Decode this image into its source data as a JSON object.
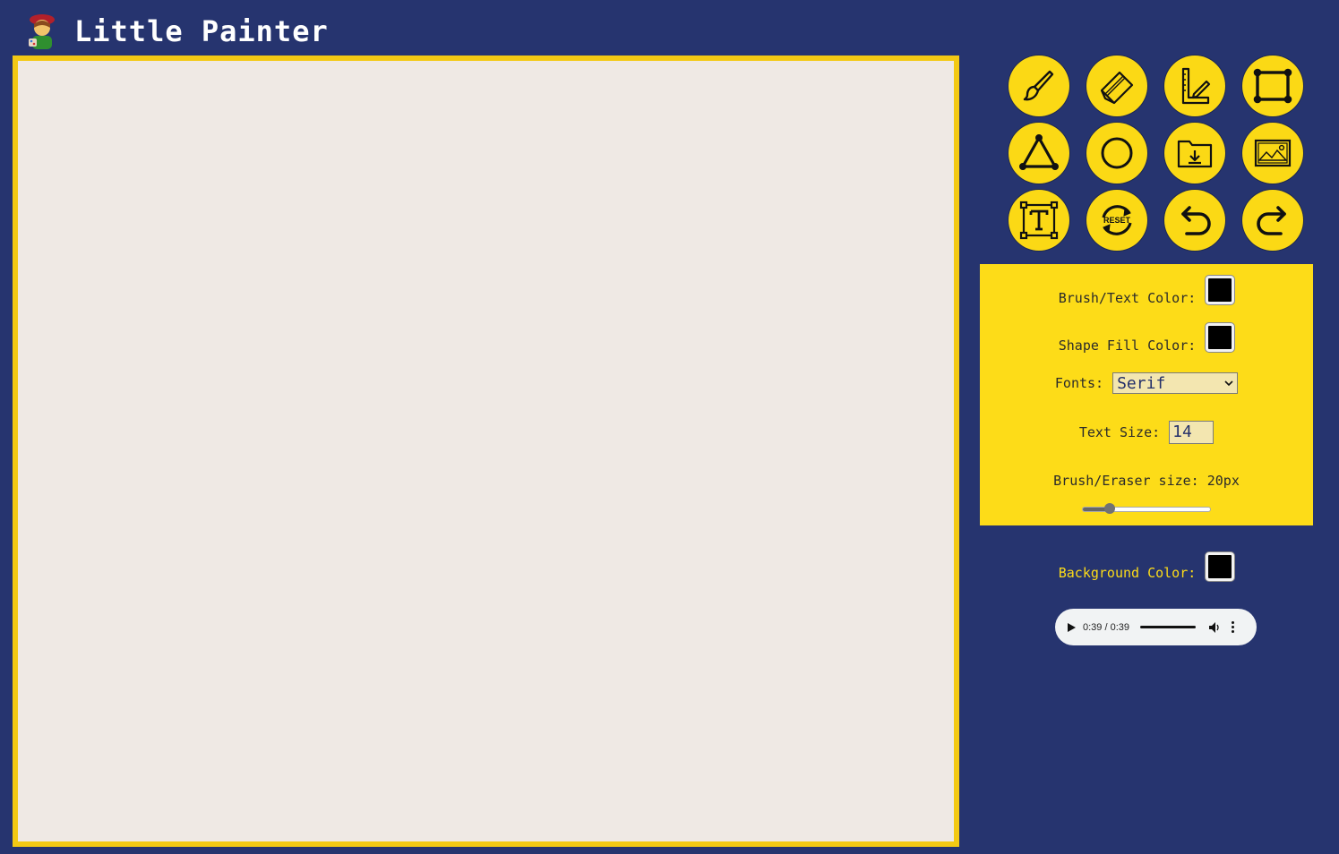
{
  "app": {
    "title": "Little Painter",
    "logo_icon": "painter-emoji-icon"
  },
  "colors": {
    "background": "#26346f",
    "accent": "#fbd915",
    "canvas": "#efe9e4"
  },
  "toolbar": {
    "tools": [
      {
        "name": "brush",
        "icon": "brush-icon"
      },
      {
        "name": "eraser",
        "icon": "eraser-icon"
      },
      {
        "name": "line",
        "icon": "ruler-pencil-icon"
      },
      {
        "name": "rectangle",
        "icon": "rectangle-icon"
      },
      {
        "name": "triangle",
        "icon": "triangle-icon"
      },
      {
        "name": "circle",
        "icon": "circle-icon"
      },
      {
        "name": "save",
        "icon": "download-folder-icon"
      },
      {
        "name": "image",
        "icon": "image-icon"
      },
      {
        "name": "text",
        "icon": "text-box-icon"
      },
      {
        "name": "reset",
        "icon": "reset-icon",
        "label": "RESET"
      },
      {
        "name": "undo",
        "icon": "undo-icon"
      },
      {
        "name": "redo",
        "icon": "redo-icon"
      }
    ]
  },
  "settings": {
    "brush_color_label": "Brush/Text Color:",
    "brush_color_value": "#000000",
    "fill_color_label": "Shape Fill Color:",
    "fill_color_value": "#000000",
    "fonts_label": "Fonts:",
    "fonts_value": "Serif",
    "text_size_label": "Text Size:",
    "text_size_value": "14",
    "brush_size_label": "Brush/Eraser size: 20px",
    "brush_size_fraction": 0.21
  },
  "background": {
    "label": "Background Color:",
    "value": "#000000"
  },
  "audio": {
    "time": "0:39 / 0:39",
    "progress": 1.0
  }
}
